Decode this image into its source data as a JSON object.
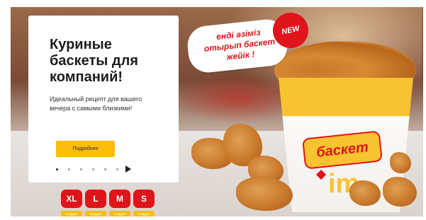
{
  "banner": {
    "title": "Куриные\nбаскеты для\nкомпаний!",
    "subtitle": "Идеальный рецепт для вашего\nвечера с самыми близкими!",
    "button_label": "Подробнее",
    "slider": {
      "total_dots": 6,
      "active_dot": 1
    },
    "bubble_text": "енді әзіміз\nотырып баскет\nжейік !",
    "new_badge": "NEW",
    "bucket_logo": "баскет",
    "bucket_brand": "im",
    "sizes": [
      {
        "label": "XL",
        "price": "6 900₸"
      },
      {
        "label": "L",
        "price": "5 500₸"
      },
      {
        "label": "M",
        "price": "5 400₸"
      },
      {
        "label": "S",
        "price": "3 400₸"
      }
    ]
  },
  "colors": {
    "accent_yellow": "#ffbc0d",
    "brand_red": "#e0141b"
  }
}
